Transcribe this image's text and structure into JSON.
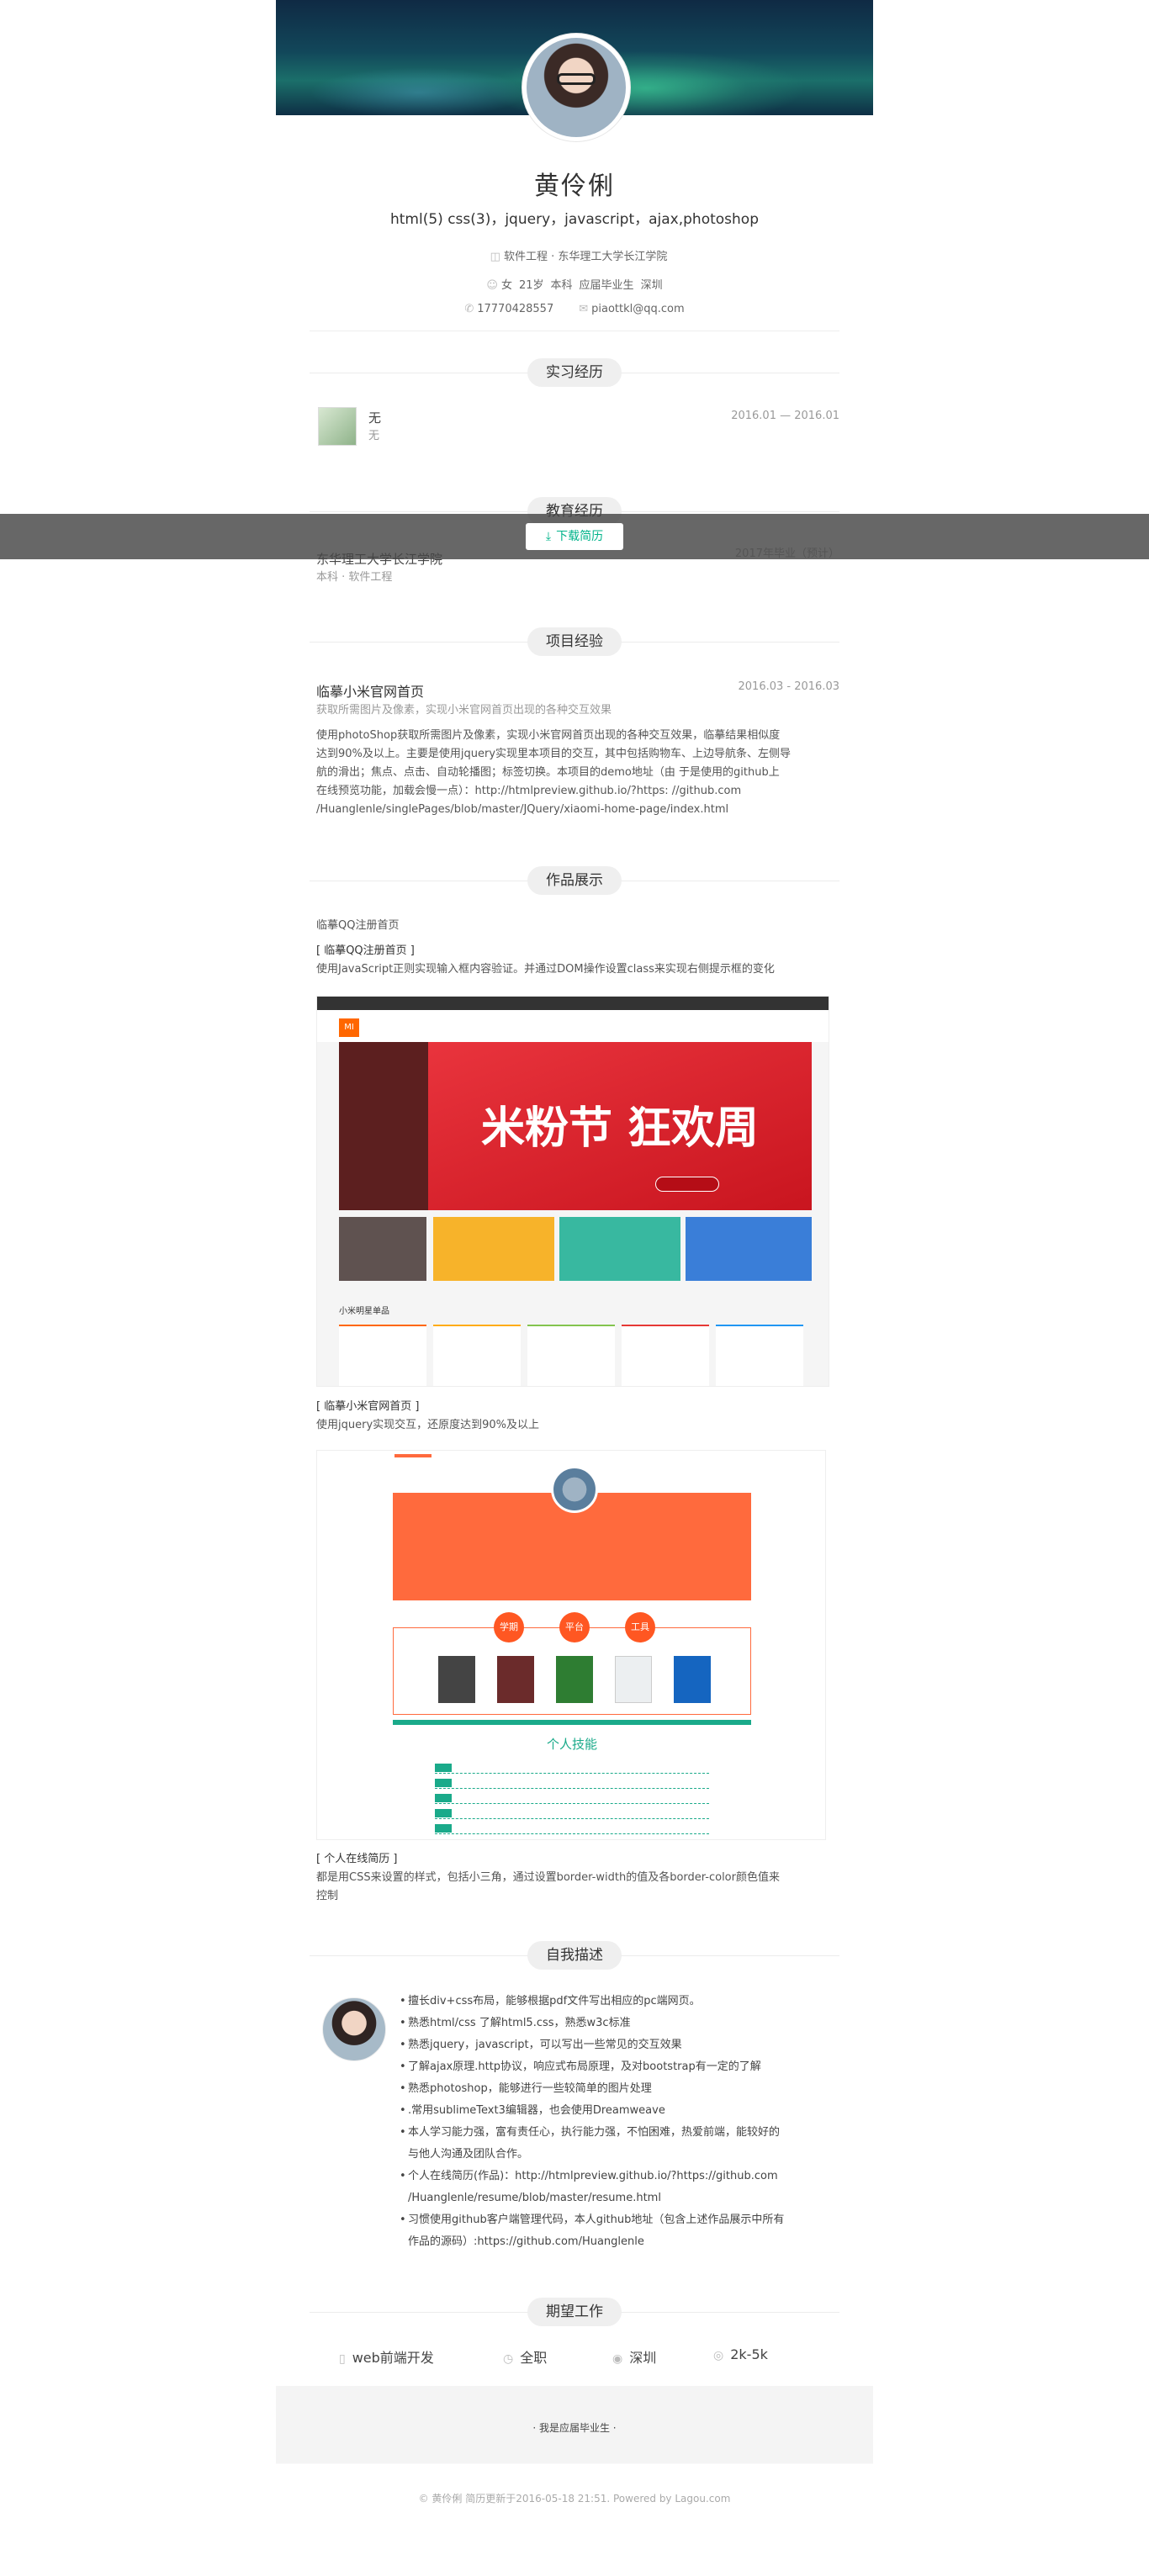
{
  "profile": {
    "name": "黄伶俐",
    "skills": "html(5) css(3)，jquery，javascript，ajax,photoshop",
    "education_line": "软件工程 · 东华理工大学长江学院",
    "info": [
      "女",
      "21岁",
      "本科",
      "应届毕业生",
      "深圳"
    ],
    "phone": "17770428557",
    "email": "piaottkl@qq.com"
  },
  "overlay": {
    "download_label": "下载简历"
  },
  "internship": {
    "title": "实习经历",
    "name": "无",
    "sub": "无",
    "period": "2016.01 — 2016.01"
  },
  "education": {
    "title": "教育经历",
    "school": "东华理工大学长江学院",
    "degree": "本科 · 软件工程",
    "period": "2017年毕业（预计）"
  },
  "project": {
    "title": "项目经验",
    "name": "临摹小米官网首页",
    "sub": "获取所需图片及像素，实现小米官网首页出现的各种交互效果",
    "period": "2016.03 - 2016.03",
    "desc": [
      "使用photoShop获取所需图片及像素，实现小米官网首页出现的各种交互效果，临摹结果相似度",
      "达到90%及以上。主要是使用jquery实现里本项目的交互，其中包括购物车、上边导航条、左侧导",
      "航的滑出；焦点、点击、自动轮播图；标签切换。本项目的demo地址（由 于是使用的github上",
      "在线预览功能，加载会慢一点）：http://htmlpreview.github.io/?https: //github.com",
      "/Huanglenle/singlePages/blob/master/JQuery/xiaomi-home-page/index.html"
    ]
  },
  "works": {
    "title": "作品展示",
    "item1_title": "临摹QQ注册首页",
    "item1_caption_title": "[ 临摹QQ注册首页 ]",
    "item1_caption": "使用JavaScript正则实现输入框内容验证。并通过DOM操作设置class来实现右侧提示框的变化",
    "mi_logo": "MI",
    "mi_banner_text": "米粉节 狂欢周",
    "mi_section": "小米明星单品",
    "item2_caption_title": "[ 临摹小米官网首页 ]",
    "item2_caption": "使用jquery实现交互，还原度达到90%及以上",
    "rs_dots": [
      "学期",
      "平台",
      "工具"
    ],
    "rs_skill_title": "个人技能",
    "item3_caption_title": "[ 个人在线简历 ]",
    "item3_caption": [
      "都是用CSS来设置的样式，包括小三角，通过设置border-width的值及各border-color颜色值来",
      "控制"
    ]
  },
  "self": {
    "title": "自我描述",
    "bullets": [
      "擅长div+css布局，能够根据pdf文件写出相应的pc端网页。",
      "熟悉html/css 了解html5.css，熟悉w3c标准",
      "熟悉jquery，javascript，可以写出一些常见的交互效果",
      "了解ajax原理.http协议，响应式布局原理，及对bootstrap有一定的了解",
      "熟悉photoshop，能够进行一些较简单的图片处理",
      ".常用sublimeText3编辑器，也会使用Dreamweave",
      "本人学习能力强，富有责任心，执行能力强，不怕困难，热爱前端，能较好的",
      "与他人沟通及团队合作。",
      "个人在线简历(作品)：http://htmlpreview.github.io/?https://github.com",
      "/Huanglenle/resume/blob/master/resume.html",
      "习惯使用github客户端管理代码，本人github地址（包含上述作品展示中所有",
      "作品的源码）:https://github.com/Huanglenle"
    ]
  },
  "expect": {
    "title": "期望工作",
    "job": "web前端开发",
    "type": "全职",
    "city": "深圳",
    "salary": "2k-5k"
  },
  "footer": {
    "status": "· 我是应届毕业生 ·",
    "copyright": "© 黄伶俐 简历更新于2016-05-18 21:51. Powered by Lagou.com"
  },
  "colors": {
    "accent": "#00b38a",
    "mi_orange": "#ff6700",
    "resume_orange": "#ff6a3d",
    "resume_green": "#1aaa8a"
  }
}
